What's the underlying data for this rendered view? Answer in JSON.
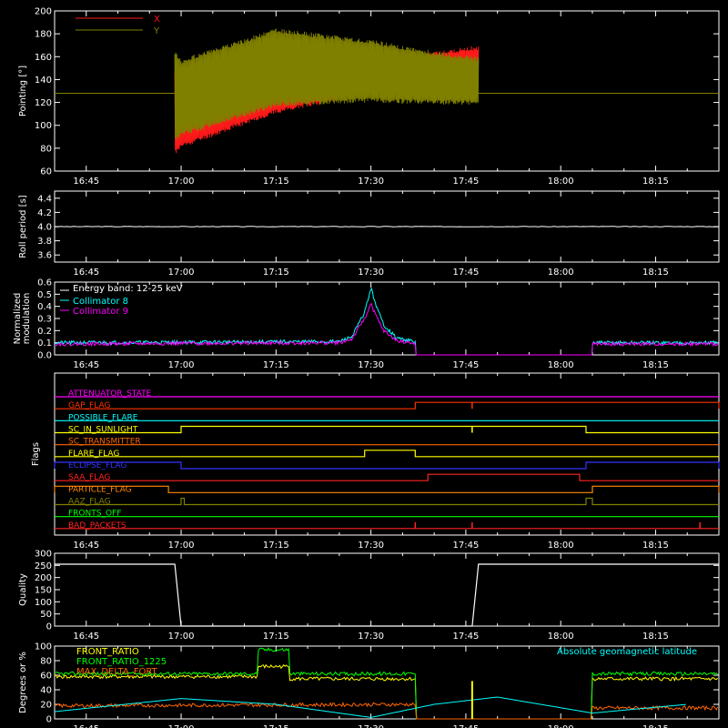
{
  "x_ticks": [
    "16:45",
    "17:00",
    "17:15",
    "17:30",
    "17:45",
    "18:00",
    "18:15"
  ],
  "chart_data": [
    {
      "type": "line",
      "ylabel": "Pointing [°]",
      "ylim": [
        60,
        200
      ],
      "yticks": [
        "60",
        "80",
        "100",
        "120",
        "140",
        "160",
        "180",
        "200"
      ],
      "grid": false,
      "legend_position": "top-left",
      "series": [
        {
          "name": "X",
          "color": "#ff1a1a",
          "x": [
            "16:59",
            "17:00",
            "17:15",
            "17:30",
            "17:40",
            "17:47"
          ],
          "band_low": [
            74,
            80,
            110,
            128,
            135,
            138
          ],
          "band_high": [
            150,
            140,
            140,
            155,
            165,
            170
          ]
        },
        {
          "name": "Y",
          "color": "#808000",
          "x": [
            "16:59",
            "17:00",
            "17:15",
            "17:30",
            "17:40",
            "17:47"
          ],
          "band_low": [
            85,
            90,
            116,
            120,
            118,
            118
          ],
          "band_high": [
            165,
            158,
            185,
            175,
            165,
            160
          ]
        }
      ],
      "reference_line": {
        "y": 128,
        "color": "#808000"
      }
    },
    {
      "type": "line",
      "ylabel": "Roll period [s]",
      "ylim": [
        3.5,
        4.5
      ],
      "yticks": [
        "3.6",
        "3.8",
        "4.0",
        "4.2",
        "4.4"
      ],
      "series": [
        {
          "name": "",
          "color": "#ffffff",
          "x": [
            "16:40",
            "18:25"
          ],
          "y": [
            4.0,
            4.0
          ]
        }
      ]
    },
    {
      "type": "line",
      "ylabel": [
        "Normalized",
        "modulation"
      ],
      "ylim": [
        0,
        0.6
      ],
      "yticks": [
        "0.0",
        "0.1",
        "0.2",
        "0.3",
        "0.4",
        "0.5",
        "0.6"
      ],
      "legend_position": "top-left",
      "legend_title": "Energy band: 12-25 keV",
      "series": [
        {
          "name": "Collimator 8",
          "color": "#00ffff",
          "x": [
            "16:40",
            "17:25",
            "17:27",
            "17:29",
            "17:30",
            "17:31",
            "17:32",
            "17:34",
            "17:36",
            "17:37",
            "17:37.1",
            "18:04.9",
            "18:05",
            "18:25"
          ],
          "y": [
            0.1,
            0.11,
            0.15,
            0.35,
            0.55,
            0.38,
            0.25,
            0.14,
            0.12,
            0.1,
            0.0,
            0.0,
            0.1,
            0.1
          ]
        },
        {
          "name": "Collimator 9",
          "color": "#ff00ff",
          "x": [
            "16:40",
            "17:25",
            "17:27",
            "17:29",
            "17:30",
            "17:31",
            "17:32",
            "17:34",
            "17:36",
            "17:37",
            "17:37.1",
            "18:04.9",
            "18:05",
            "18:25"
          ],
          "y": [
            0.09,
            0.1,
            0.13,
            0.3,
            0.42,
            0.3,
            0.2,
            0.12,
            0.1,
            0.09,
            0.0,
            0.0,
            0.09,
            0.09
          ]
        }
      ]
    },
    {
      "type": "line",
      "ylabel": "Flags",
      "series": [
        {
          "name": "ATTENUATOR_STATE",
          "color": "#ff00ff",
          "segments": []
        },
        {
          "name": "GAP_FLAG",
          "color": "#ff3300",
          "segments": [
            [
              "17:37",
              "18:25"
            ]
          ],
          "spikes": [
            "17:46"
          ]
        },
        {
          "name": "POSSIBLE_FLARE",
          "color": "#00ffff",
          "segments": []
        },
        {
          "name": "SC_IN_SUNLIGHT",
          "color": "#ffff00",
          "segments": [
            [
              "17:00",
              "18:04"
            ]
          ],
          "spikes": [
            "17:46"
          ]
        },
        {
          "name": "SC_TRANSMITTER",
          "color": "#ff6600",
          "segments": []
        },
        {
          "name": "FLARE_FLAG",
          "color": "#ffff00",
          "segments": [
            [
              "17:29",
              "17:37"
            ]
          ]
        },
        {
          "name": "ECLIPSE_FLAG",
          "color": "#3333ff",
          "segments": [
            [
              "16:40",
              "17:00"
            ],
            [
              "18:04",
              "18:25"
            ]
          ]
        },
        {
          "name": "SAA_FLAG",
          "color": "#ff2222",
          "segments": [
            [
              "17:39",
              "18:03"
            ]
          ]
        },
        {
          "name": "PARTICLE_FLAG",
          "color": "#ff8800",
          "segments": [
            [
              "16:40",
              "16:58"
            ],
            [
              "18:05",
              "18:25"
            ]
          ]
        },
        {
          "name": "AAZ_FLAG",
          "color": "#808000",
          "segments": [
            [
              "17:00",
              "17:00.5"
            ],
            [
              "18:04",
              "18:05"
            ]
          ]
        },
        {
          "name": "FRONTS_OFF",
          "color": "#00ff00",
          "segments": []
        },
        {
          "name": "BAD_PACKETS",
          "color": "#ff2222",
          "segments": [],
          "spikes": [
            "17:37",
            "17:46",
            "18:22"
          ]
        }
      ]
    },
    {
      "type": "line",
      "ylabel": "Quality",
      "ylim": [
        0,
        300
      ],
      "yticks": [
        "0",
        "50",
        "100",
        "150",
        "200",
        "250",
        "300"
      ],
      "series": [
        {
          "name": "",
          "color": "#ffffff",
          "x": [
            "16:40",
            "16:59",
            "17:00",
            "17:46",
            "17:47",
            "18:25"
          ],
          "y": [
            255,
            255,
            0,
            0,
            255,
            255
          ]
        }
      ]
    },
    {
      "type": "line",
      "ylabel": "Degrees or %",
      "ylim": [
        0,
        100
      ],
      "yticks": [
        "0",
        "20",
        "40",
        "60",
        "80",
        "100"
      ],
      "annotation": "Absolute geomagnetic latitude",
      "legend_position": "top-left",
      "series": [
        {
          "name": "FRONT_RATIO",
          "color": "#ffff00",
          "x": [
            "16:40",
            "17:12",
            "17:12.1",
            "17:17",
            "17:17.1",
            "17:37",
            "17:37.1",
            "18:04.9",
            "18:05",
            "18:25"
          ],
          "y": [
            58,
            58,
            72,
            72,
            55,
            55,
            0,
            0,
            55,
            55
          ]
        },
        {
          "name": "FRONT_RATIO_1225",
          "color": "#00ff00",
          "x": [
            "16:40",
            "17:12",
            "17:12.1",
            "17:17",
            "17:17.1",
            "17:37",
            "17:37.1",
            "18:04.9",
            "18:05",
            "18:25"
          ],
          "y": [
            62,
            62,
            95,
            95,
            62,
            62,
            0,
            0,
            62,
            62
          ]
        },
        {
          "name": "MAX_DELTA_FORT",
          "color": "#ff6600",
          "x": [
            "16:40",
            "17:37",
            "17:37.1",
            "18:04.9",
            "18:05",
            "18:25"
          ],
          "y": [
            18,
            20,
            0,
            0,
            15,
            15
          ]
        },
        {
          "name": "Absolute geomagnetic latitude",
          "color": "#00ffff",
          "x": [
            "16:40",
            "17:00",
            "17:15",
            "17:30",
            "17:40",
            "17:50",
            "18:05",
            "18:20"
          ],
          "y": [
            10,
            28,
            20,
            2,
            20,
            30,
            8,
            20
          ]
        }
      ]
    }
  ]
}
